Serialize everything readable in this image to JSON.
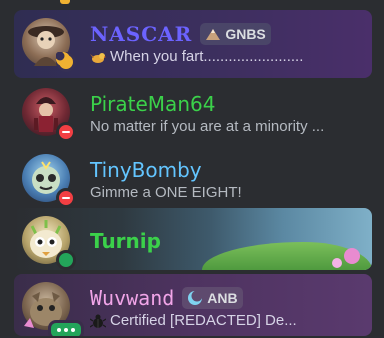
{
  "members": [
    {
      "name": "NASCAR",
      "tag": "GNBS",
      "tag_icon": "mountain-icon",
      "status": "idle",
      "activity_emoji": "bird-emoji",
      "activity": "When you fart........................"
    },
    {
      "name": "PirateMan64",
      "status": "dnd",
      "activity": "No matter if you are at a minority ..."
    },
    {
      "name": "TinyBomby",
      "status": "dnd",
      "activity": "Gimme a ONE EIGHT!"
    },
    {
      "name": "Turnip",
      "status": "online"
    },
    {
      "name": "Wuvwand",
      "tag": "ANB",
      "tag_icon": "moon-icon",
      "status": "typing",
      "activity_emoji": "beetle-emoji",
      "activity": "Certified [REDACTED] De..."
    }
  ],
  "colors": {
    "background": "#2b2d31",
    "nascar": "#6c63ff",
    "pirateman": "#3bd14a",
    "tinybomby": "#63c5ff",
    "turnip": "#3bd14a",
    "wuvwand": "#f1a5e8",
    "online": "#23a55a",
    "dnd": "#f23f43",
    "idle": "#f0b232"
  }
}
